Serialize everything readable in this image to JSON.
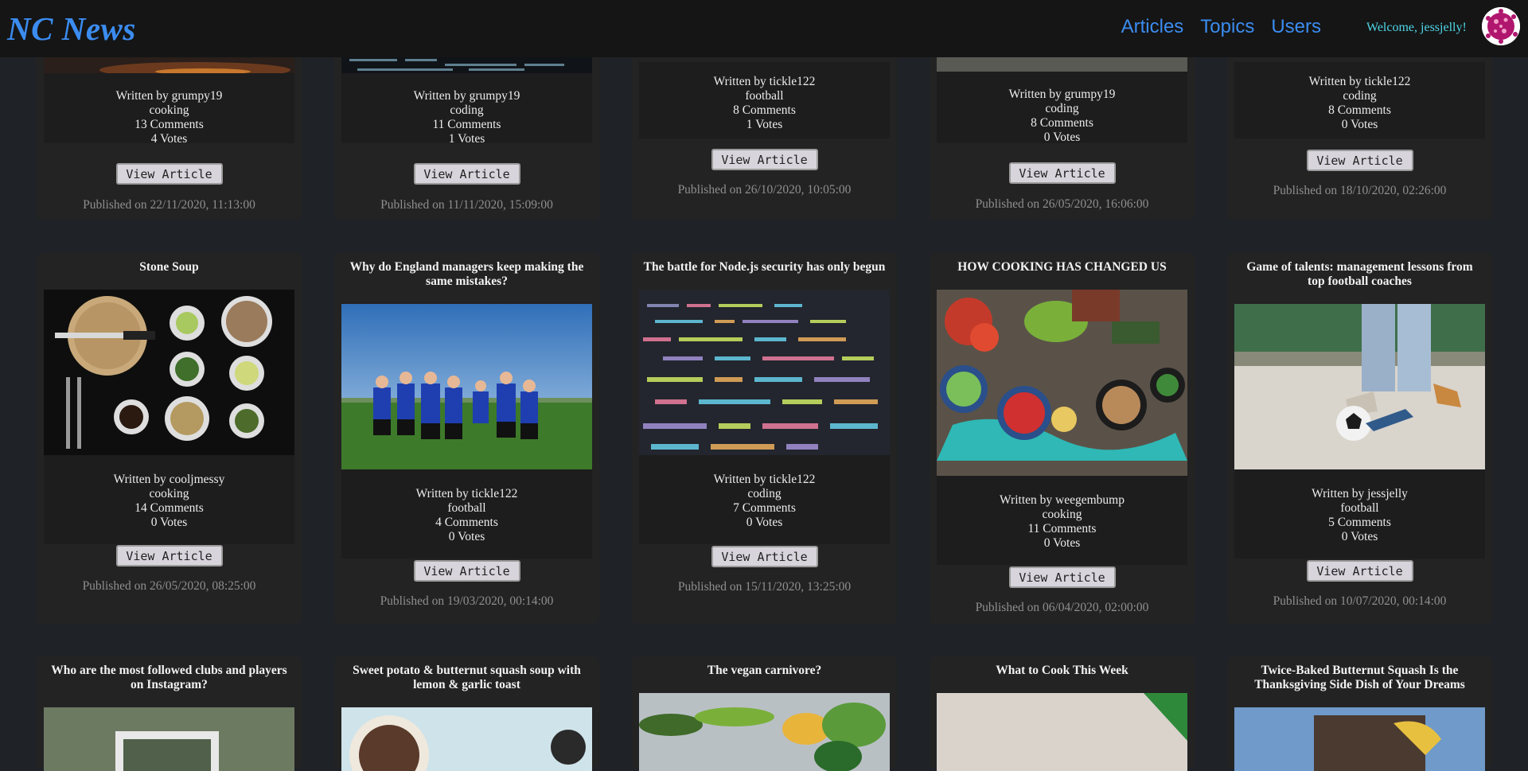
{
  "nav": {
    "brand": "NC News",
    "links": [
      "Articles",
      "Topics",
      "Users"
    ],
    "welcome": "Welcome, jessjelly!"
  },
  "row1": [
    {
      "author": "Written by grumpy19",
      "topic": "cooking",
      "comments": "13 Comments",
      "votes": "4 Votes",
      "button": "View Article",
      "published": "Published on 22/11/2020, 11:13:00"
    },
    {
      "author": "Written by grumpy19",
      "topic": "coding",
      "comments": "11 Comments",
      "votes": "1 Votes",
      "button": "View Article",
      "published": "Published on 11/11/2020, 15:09:00"
    },
    {
      "author": "Written by tickle122",
      "topic": "football",
      "comments": "8 Comments",
      "votes": "1 Votes",
      "button": "View Article",
      "published": "Published on 26/10/2020, 10:05:00"
    },
    {
      "author": "Written by grumpy19",
      "topic": "coding",
      "comments": "8 Comments",
      "votes": "0 Votes",
      "button": "View Article",
      "published": "Published on 26/05/2020, 16:06:00"
    },
    {
      "author": "Written by tickle122",
      "topic": "coding",
      "comments": "8 Comments",
      "votes": "0 Votes",
      "button": "View Article",
      "published": "Published on 18/10/2020, 02:26:00"
    }
  ],
  "row2": [
    {
      "title": "Stone Soup",
      "author": "Written by cooljmessy",
      "topic": "cooking",
      "comments": "14 Comments",
      "votes": "0 Votes",
      "button": "View Article",
      "published": "Published on 26/05/2020, 08:25:00"
    },
    {
      "title": "Why do England managers keep making the same mistakes?",
      "author": "Written by tickle122",
      "topic": "football",
      "comments": "4 Comments",
      "votes": "0 Votes",
      "button": "View Article",
      "published": "Published on 19/03/2020, 00:14:00"
    },
    {
      "title": "The battle for Node.js security has only begun",
      "author": "Written by tickle122",
      "topic": "coding",
      "comments": "7 Comments",
      "votes": "0 Votes",
      "button": "View Article",
      "published": "Published on 15/11/2020, 13:25:00"
    },
    {
      "title": "HOW COOKING HAS CHANGED US",
      "author": "Written by weegembump",
      "topic": "cooking",
      "comments": "11 Comments",
      "votes": "0 Votes",
      "button": "View Article",
      "published": "Published on 06/04/2020, 02:00:00"
    },
    {
      "title": "Game of talents: management lessons from top football coaches",
      "author": "Written by jessjelly",
      "topic": "football",
      "comments": "5 Comments",
      "votes": "0 Votes",
      "button": "View Article",
      "published": "Published on 10/07/2020, 00:14:00"
    }
  ],
  "row3": [
    {
      "title": "Who are the most followed clubs and players on Instagram?"
    },
    {
      "title": "Sweet potato & butternut squash soup with lemon & garlic toast"
    },
    {
      "title": "The vegan carnivore?"
    },
    {
      "title": "What to Cook This Week"
    },
    {
      "title": "Twice-Baked Butternut Squash Is the Thanksgiving Side Dish of Your Dreams"
    }
  ]
}
